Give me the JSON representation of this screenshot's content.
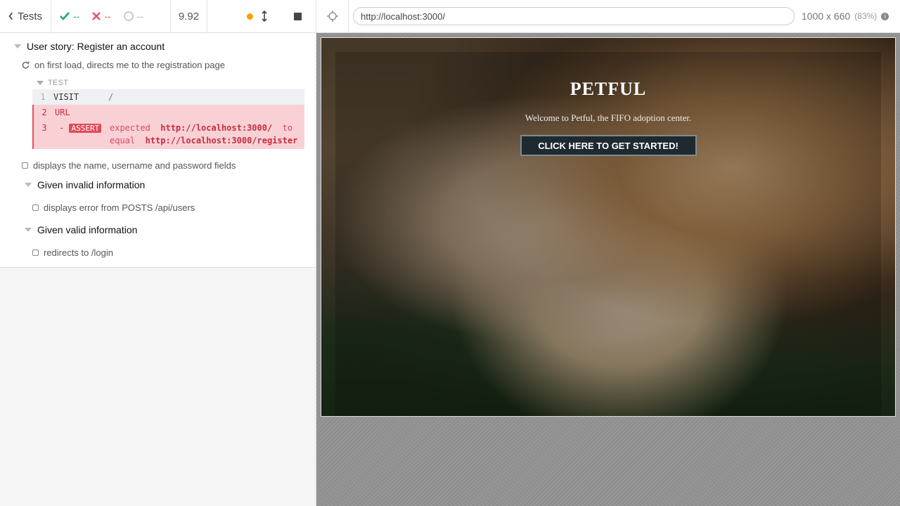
{
  "header": {
    "back_label": "Tests",
    "passed": "--",
    "failed": "--",
    "pending": "--",
    "duration": "9.92"
  },
  "runnables": {
    "suite_title": "User story: Register an account",
    "test1_title": "on first load, directs me to the registration page",
    "test_label": "TEST",
    "commands": [
      {
        "num": "1",
        "name": "VISIT",
        "message": "/"
      },
      {
        "num": "2",
        "name": "URL",
        "message": ""
      },
      {
        "num": "3",
        "name": "-",
        "badge": "ASSERT",
        "msg_prefix": "expected",
        "msg_expected": "http://localhost:3000/",
        "msg_to": "to",
        "msg_equal": "equal",
        "msg_target": "http://localhost:3000/register"
      }
    ],
    "test2_title": "displays the name, username and password fields",
    "suite_invalid": "Given invalid information",
    "test3_title": "displays error from POSTS /api/users",
    "suite_valid": "Given valid information",
    "test4_title": "redirects to /login"
  },
  "aut": {
    "url": "http://localhost:3000/",
    "viewport": "1000 x 660",
    "scale": "(83%)"
  },
  "app": {
    "title": "PETFUL",
    "subtitle": "Welcome to Petful, the FIFO adoption center.",
    "cta_label": "CLICK HERE TO GET STARTED!"
  },
  "colors": {
    "pass": "#1fa971",
    "fail": "#e94f5f",
    "running": "#f3a300"
  }
}
